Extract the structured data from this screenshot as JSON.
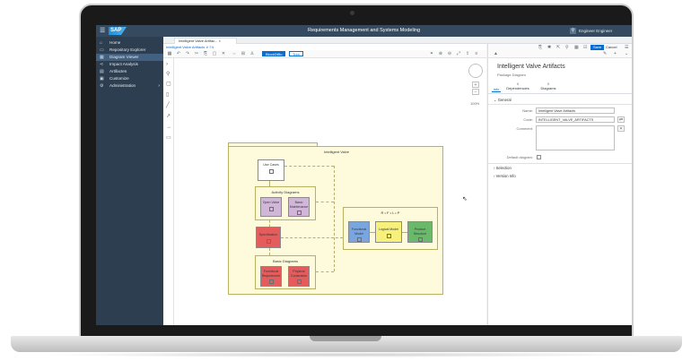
{
  "app": {
    "title": "Requirements Management and Systems Modeling",
    "user": "Engineer Engineer"
  },
  "nav": {
    "items": [
      {
        "label": "Home",
        "icon": "home-icon"
      },
      {
        "label": "Repository Explorer",
        "icon": "folder-icon"
      },
      {
        "label": "Diagram Viewer",
        "icon": "diagram-icon",
        "active": true
      },
      {
        "label": "Impact Analysis",
        "icon": "share-icon"
      },
      {
        "label": "Artifactes",
        "icon": "document-icon"
      },
      {
        "label": "Customize",
        "icon": "settings-icon"
      },
      {
        "label": "Administration",
        "icon": "gear-icon"
      }
    ]
  },
  "tab": {
    "label": "Intelligent Valve Artifac... ×"
  },
  "breadcrumb": "Intelligent Valve Artifacts ∨  ≡∨",
  "toolbar": {
    "btn1": "BlockDiBu",
    "btn2": "Trim"
  },
  "diagram": {
    "package": "Intelligent Valve",
    "use_cases": "Use Cases",
    "activity": "Activity Diagrams",
    "open_valve": "Open Valve",
    "basic_maint": "Basic Maintenance",
    "spec": "Specification",
    "basic": "Basic Diagrams",
    "func_req": "Functional Requirement",
    "phys_const": "Physical Constraints",
    "rfl": "R • F • L • P",
    "func_model": "Functional Model",
    "logic_model": "Logical Model",
    "product_struct": "Product Structure",
    "zoom": "100%"
  },
  "props": {
    "title": "Intelligent Valve Artifacts",
    "subtitle": "Package Diagram",
    "tabs": [
      {
        "label": "Info",
        "count": ""
      },
      {
        "label": "Dependencies",
        "count": "0"
      },
      {
        "label": "Diagrams",
        "count": "0"
      }
    ],
    "general": "General",
    "name_label": "Name:",
    "name_value": "Intelligent Valve Artifacts",
    "code_label": "Code:",
    "code_value": "INTELLIGENT_VALVE_ARTIFACTS",
    "comment_label": "Comment:",
    "default_label": "Default diagram:",
    "selection": "Selection",
    "version": "Version Info",
    "save": "Save",
    "cancel": "Cancel"
  },
  "colors": {
    "shell": "#354a5f",
    "nav": "#2c3e50",
    "accent": "#0a6ed1",
    "package": "#fdfbdc",
    "purple": "#d2b6da",
    "red": "#e45c5c",
    "blue": "#7aa6e0",
    "yellow": "#f7f07a",
    "green": "#6ab86a"
  }
}
